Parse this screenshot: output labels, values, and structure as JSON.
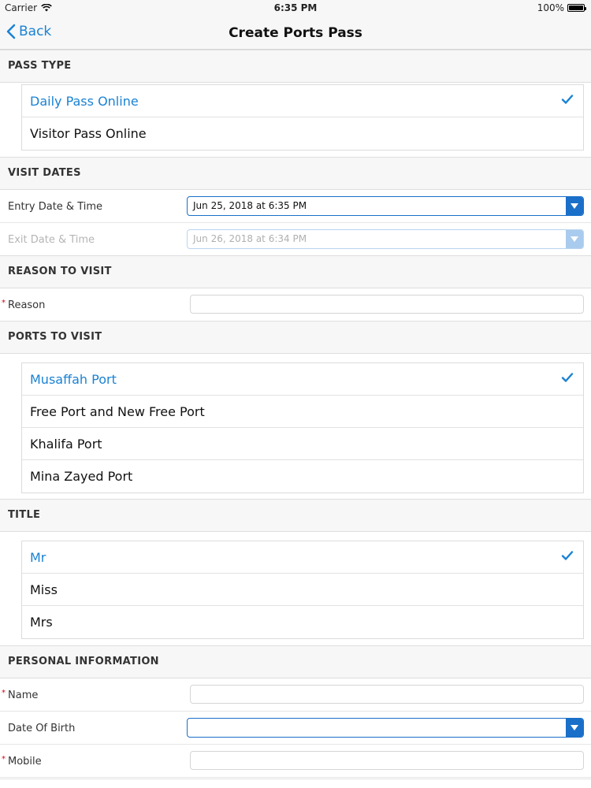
{
  "status_bar": {
    "carrier": "Carrier",
    "time": "6:35 PM",
    "battery": "100%"
  },
  "nav": {
    "back_label": "Back",
    "title": "Create Ports Pass"
  },
  "pass_type": {
    "header": "PASS TYPE",
    "options": [
      {
        "label": "Daily Pass Online",
        "selected": true
      },
      {
        "label": "Visitor Pass Online",
        "selected": false
      }
    ]
  },
  "visit_dates": {
    "header": "VISIT DATES",
    "entry_label": "Entry Date & Time",
    "entry_value": "Jun 25, 2018 at 6:35 PM",
    "exit_label": "Exit Date & Time",
    "exit_value": "Jun 26, 2018 at 6:34 PM"
  },
  "reason": {
    "header": "REASON TO VISIT",
    "label": "Reason",
    "required_mark": "*",
    "value": ""
  },
  "ports": {
    "header": "PORTS TO VISIT",
    "options": [
      {
        "label": "Musaffah Port",
        "selected": true
      },
      {
        "label": "Free Port and New Free Port",
        "selected": false
      },
      {
        "label": "Khalifa Port",
        "selected": false
      },
      {
        "label": "Mina Zayed Port",
        "selected": false
      }
    ]
  },
  "title_section": {
    "header": "TITLE",
    "options": [
      {
        "label": "Mr",
        "selected": true
      },
      {
        "label": "Miss",
        "selected": false
      },
      {
        "label": "Mrs",
        "selected": false
      }
    ]
  },
  "personal": {
    "header": "PERSONAL INFORMATION",
    "name_label": "Name",
    "dob_label": "Date Of Birth",
    "mobile_label": "Mobile",
    "required_mark": "*"
  },
  "colors": {
    "accent": "#1a82d4",
    "select_accent": "#1a6fc9",
    "required": "#d0021b"
  },
  "icons": {
    "checkmark": "checkmark-icon",
    "back": "chevron-left-icon",
    "dropdown": "caret-down-icon"
  }
}
